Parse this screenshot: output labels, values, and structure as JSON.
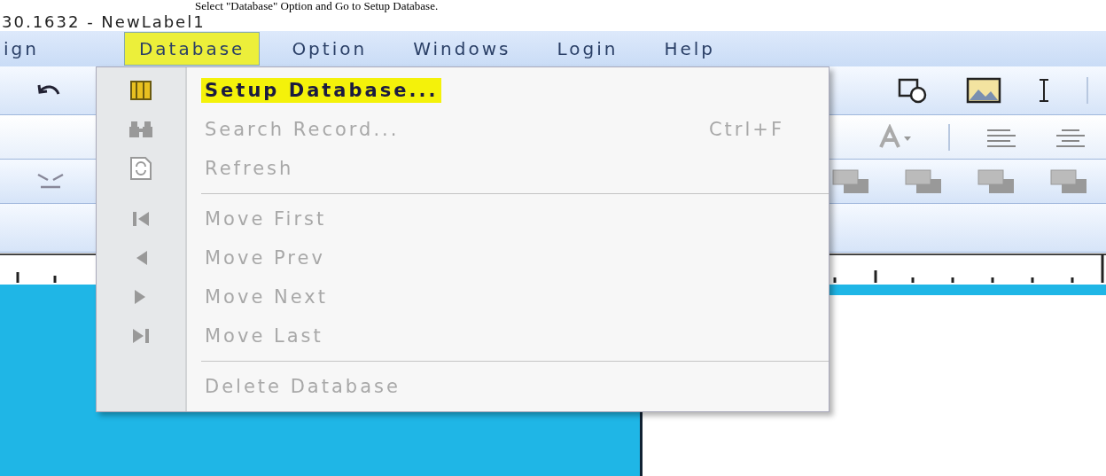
{
  "caption": "Select \"Database\" Option and Go to Setup Database.",
  "window": {
    "title": "30.1632  - NewLabel1"
  },
  "menubar": [
    {
      "label": "ign",
      "selected": false
    },
    {
      "label": "Database",
      "selected": true
    },
    {
      "label": "Option",
      "selected": false
    },
    {
      "label": "Windows",
      "selected": false
    },
    {
      "label": "Login",
      "selected": false
    },
    {
      "label": "Help",
      "selected": false
    }
  ],
  "menu": {
    "items": [
      {
        "kind": "item",
        "label": "Setup Database...",
        "disabled": false,
        "selected": true
      },
      {
        "kind": "item",
        "label": "Search Record...",
        "shortcut": "Ctrl+F",
        "disabled": true,
        "selected": false
      },
      {
        "kind": "item",
        "label": "Refresh",
        "disabled": true,
        "selected": false
      },
      {
        "kind": "separator"
      },
      {
        "kind": "item",
        "label": "Move First",
        "disabled": true,
        "selected": false
      },
      {
        "kind": "item",
        "label": "Move Prev",
        "disabled": true,
        "selected": false
      },
      {
        "kind": "item",
        "label": "Move Next",
        "disabled": true,
        "selected": false
      },
      {
        "kind": "item",
        "label": "Move Last",
        "disabled": true,
        "selected": false
      },
      {
        "kind": "separator"
      },
      {
        "kind": "item",
        "label": "Delete Database",
        "disabled": true,
        "selected": false
      }
    ]
  }
}
